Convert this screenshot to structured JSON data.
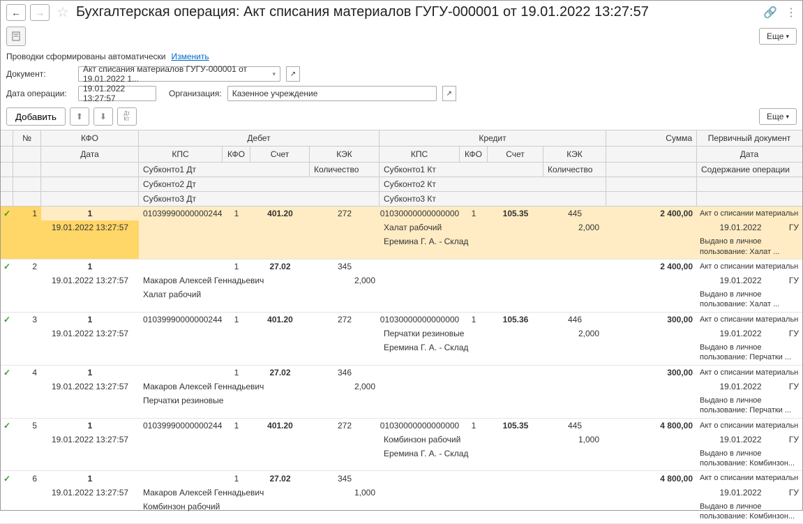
{
  "header": {
    "title": "Бухгалтерская операция: Акт списания материалов ГУГУ-000001 от 19.01.2022 13:27:57",
    "more_btn": "Еще"
  },
  "info": {
    "auto_label": "Проводки сформированы автоматически",
    "change_link": "Изменить"
  },
  "form": {
    "doc_label": "Документ:",
    "doc_value": "Акт списания материалов ГУГУ-000001 от 19.01.2022 1...",
    "date_label": "Дата операции:",
    "date_value": "19.01.2022 13:27:57",
    "org_label": "Организация:",
    "org_value": "Казенное учреждение"
  },
  "actions": {
    "add": "Добавить",
    "more": "Еще"
  },
  "columns": {
    "num": "№",
    "kfo": "КФО",
    "date": "Дата",
    "debit": "Дебет",
    "credit": "Кредит",
    "sum": "Сумма",
    "prim": "Первичный документ",
    "kps": "КПС",
    "kfo2": "КФО",
    "acct": "Счет",
    "kek": "КЭК",
    "qty": "Количество",
    "sub1d": "Субконто1 Дт",
    "sub2d": "Субконто2 Дт",
    "sub3d": "Субконто3 Дт",
    "sub1k": "Субконто1 Кт",
    "sub2k": "Субконто2 Кт",
    "sub3k": "Субконто3 Кт",
    "prim_date": "Дата",
    "content": "Содержание операции"
  },
  "rows": [
    {
      "num": "1",
      "kfo": "1",
      "date": "19.01.2022 13:27:57",
      "d_kps": "01039990000000244",
      "d_kfo": "1",
      "d_acct": "401.20",
      "d_kek": "272",
      "k_kps": "01030000000000000",
      "k_kfo": "1",
      "k_acct": "105.35",
      "k_kek": "445",
      "sum": "2 400,00",
      "prim_title": "Акт о списании материальн",
      "prim_date": "19.01.2022",
      "prim_gu": "ГУ",
      "k_sub1": "Халат рабочий",
      "k_qty": "2,000",
      "k_sub2": "Еремина Г. А. - Склад",
      "content": "Выдано в личное пользование: Халат ..."
    },
    {
      "num": "2",
      "kfo": "1",
      "date": "19.01.2022 13:27:57",
      "d_kps": "",
      "d_kfo": "1",
      "d_acct": "27.02",
      "d_kek": "345",
      "d_qty": "2,000",
      "sum": "2 400,00",
      "prim_title": "Акт о списании материальн",
      "prim_date": "19.01.2022",
      "prim_gu": "ГУ",
      "d_sub1": "Макаров Алексей Геннадьевич",
      "d_sub2": "Халат рабочий",
      "content": "Выдано в личное пользование: Халат ..."
    },
    {
      "num": "3",
      "kfo": "1",
      "date": "19.01.2022 13:27:57",
      "d_kps": "01039990000000244",
      "d_kfo": "1",
      "d_acct": "401.20",
      "d_kek": "272",
      "k_kps": "01030000000000000",
      "k_kfo": "1",
      "k_acct": "105.36",
      "k_kek": "446",
      "sum": "300,00",
      "prim_title": "Акт о списании материальн",
      "prim_date": "19.01.2022",
      "prim_gu": "ГУ",
      "k_sub1": "Перчатки резиновые",
      "k_qty": "2,000",
      "k_sub2": "Еремина Г. А. - Склад",
      "content": "Выдано в личное пользование: Перчатки ..."
    },
    {
      "num": "4",
      "kfo": "1",
      "date": "19.01.2022 13:27:57",
      "d_kps": "",
      "d_kfo": "1",
      "d_acct": "27.02",
      "d_kek": "346",
      "d_qty": "2,000",
      "sum": "300,00",
      "prim_title": "Акт о списании материальн",
      "prim_date": "19.01.2022",
      "prim_gu": "ГУ",
      "d_sub1": "Макаров Алексей Геннадьевич",
      "d_sub2": "Перчатки резиновые",
      "content": "Выдано в личное пользование: Перчатки ..."
    },
    {
      "num": "5",
      "kfo": "1",
      "date": "19.01.2022 13:27:57",
      "d_kps": "01039990000000244",
      "d_kfo": "1",
      "d_acct": "401.20",
      "d_kek": "272",
      "k_kps": "01030000000000000",
      "k_kfo": "1",
      "k_acct": "105.35",
      "k_kek": "445",
      "sum": "4 800,00",
      "prim_title": "Акт о списании материальн",
      "prim_date": "19.01.2022",
      "prim_gu": "ГУ",
      "k_sub1": "Комбинзон рабочий",
      "k_qty": "1,000",
      "k_sub2": "Еремина Г. А. - Склад",
      "content": "Выдано в личное пользование: Комбинзон..."
    },
    {
      "num": "6",
      "kfo": "1",
      "date": "19.01.2022 13:27:57",
      "d_kps": "",
      "d_kfo": "1",
      "d_acct": "27.02",
      "d_kek": "345",
      "d_qty": "1,000",
      "sum": "4 800,00",
      "prim_title": "Акт о списании материальн",
      "prim_date": "19.01.2022",
      "prim_gu": "ГУ",
      "d_sub1": "Макаров Алексей Геннадьевич",
      "d_sub2": "Комбинзон рабочий",
      "content": "Выдано в личное пользование: Комбинзон..."
    }
  ]
}
